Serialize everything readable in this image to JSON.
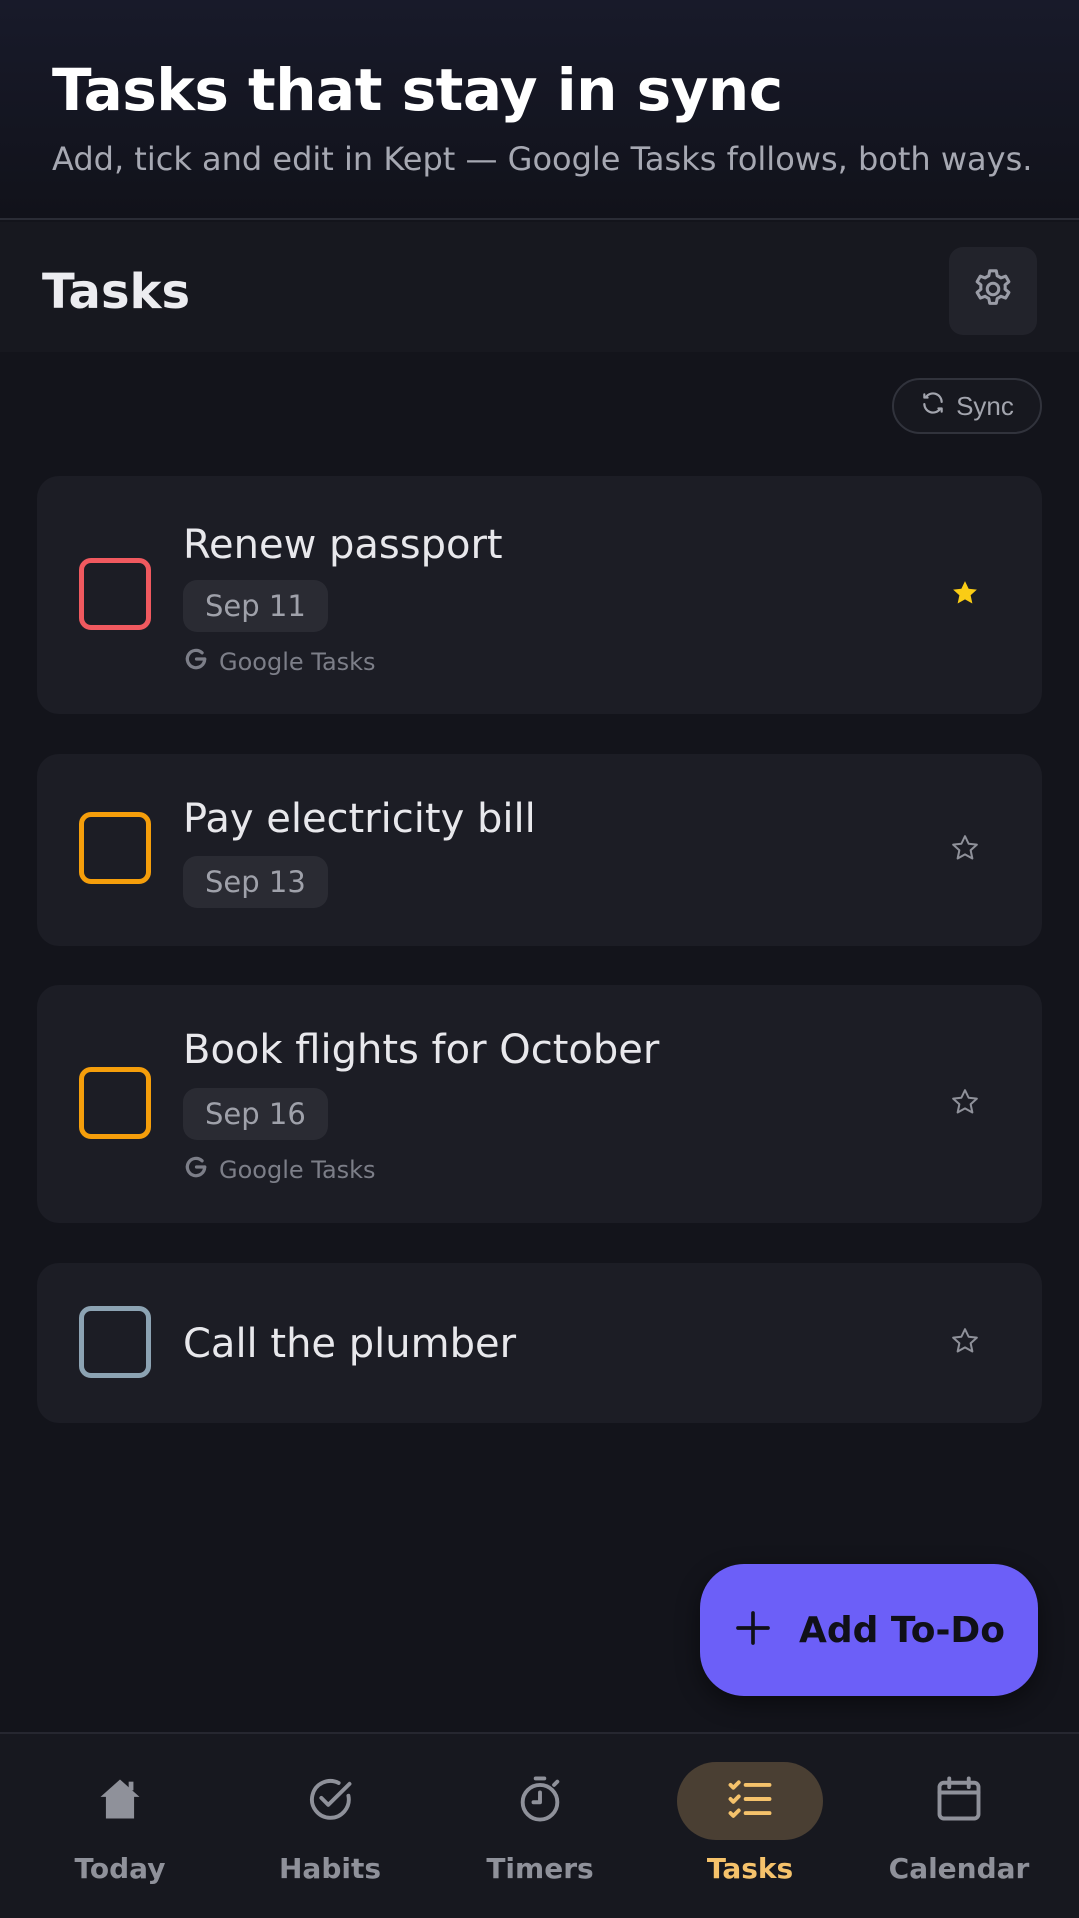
{
  "promo": {
    "title": "Tasks that stay in sync",
    "subtitle": "Add, tick and edit in Kept — Google Tasks follows, both ways."
  },
  "header": {
    "title": "Tasks",
    "settings_icon": "gear-icon"
  },
  "sync_button": {
    "label": "Sync",
    "icon": "sync-icon"
  },
  "tasks": [
    {
      "title": "Renew passport",
      "date": "Sep 11",
      "source": "Google Tasks",
      "starred": true,
      "checkbox_color": "#f0595f"
    },
    {
      "title": "Pay electricity bill",
      "date": "Sep 13",
      "source": "",
      "starred": false,
      "checkbox_color": "#f59e0b"
    },
    {
      "title": "Book flights for October",
      "date": "Sep 16",
      "source": "Google Tasks",
      "starred": false,
      "checkbox_color": "#f59e0b"
    },
    {
      "title": "Call the plumber",
      "date": "",
      "source": "",
      "starred": false,
      "checkbox_color": "#8ca3b3"
    }
  ],
  "fab": {
    "label": "Add To-Do",
    "icon": "plus-icon"
  },
  "nav": {
    "items": [
      {
        "label": "Today",
        "icon": "home-icon",
        "active": false
      },
      {
        "label": "Habits",
        "icon": "check-circle-icon",
        "active": false
      },
      {
        "label": "Timers",
        "icon": "stopwatch-icon",
        "active": false
      },
      {
        "label": "Tasks",
        "icon": "checklist-icon",
        "active": true
      },
      {
        "label": "Calendar",
        "icon": "calendar-icon",
        "active": false
      }
    ]
  },
  "colors": {
    "accent": "#6c5ff8",
    "active_nav": "#f5c26b",
    "star_active": "#facc15",
    "background": "#13141b",
    "card": "#1c1d25"
  }
}
